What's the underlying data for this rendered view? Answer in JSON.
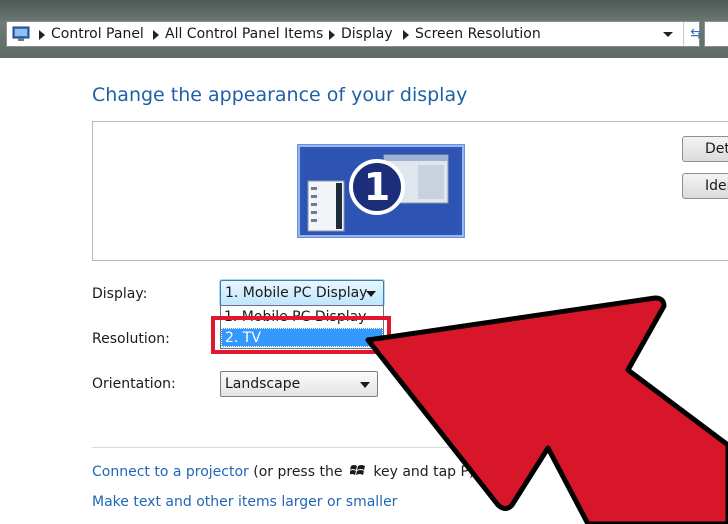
{
  "breadcrumb": {
    "items": [
      "Control Panel",
      "All Control Panel Items",
      "Display",
      "Screen Resolution"
    ]
  },
  "page": {
    "heading": "Change the appearance of your display"
  },
  "monitor": {
    "number": "1"
  },
  "side_buttons": {
    "detect_label": "Detect",
    "identify_label": "Identify"
  },
  "settings": {
    "display_label": "Display:",
    "display_value": "1. Mobile PC Display",
    "resolution_label": "Resolution:",
    "orientation_label": "Orientation:",
    "orientation_value": "Landscape"
  },
  "display_dropdown": {
    "options": [
      "1. Mobile PC Display",
      "2. TV"
    ],
    "selected_index": 1
  },
  "links": {
    "projector_link": "Connect to a projector",
    "projector_hint_prefix": "(or press the",
    "projector_hint_suffix": "key and tap P)",
    "text_size_link": "Make text and other items larger or smaller"
  },
  "colors": {
    "accent_blue": "#1f5fa8",
    "highlight_red": "#e0182d",
    "arrow_red": "#d8162a",
    "selection_blue": "#3399ff"
  },
  "icons": {
    "address_bar": "control-panel-icon",
    "refresh": "refresh-icon",
    "windows_key": "windows-logo-icon",
    "overlay": "red-arrow-icon"
  }
}
